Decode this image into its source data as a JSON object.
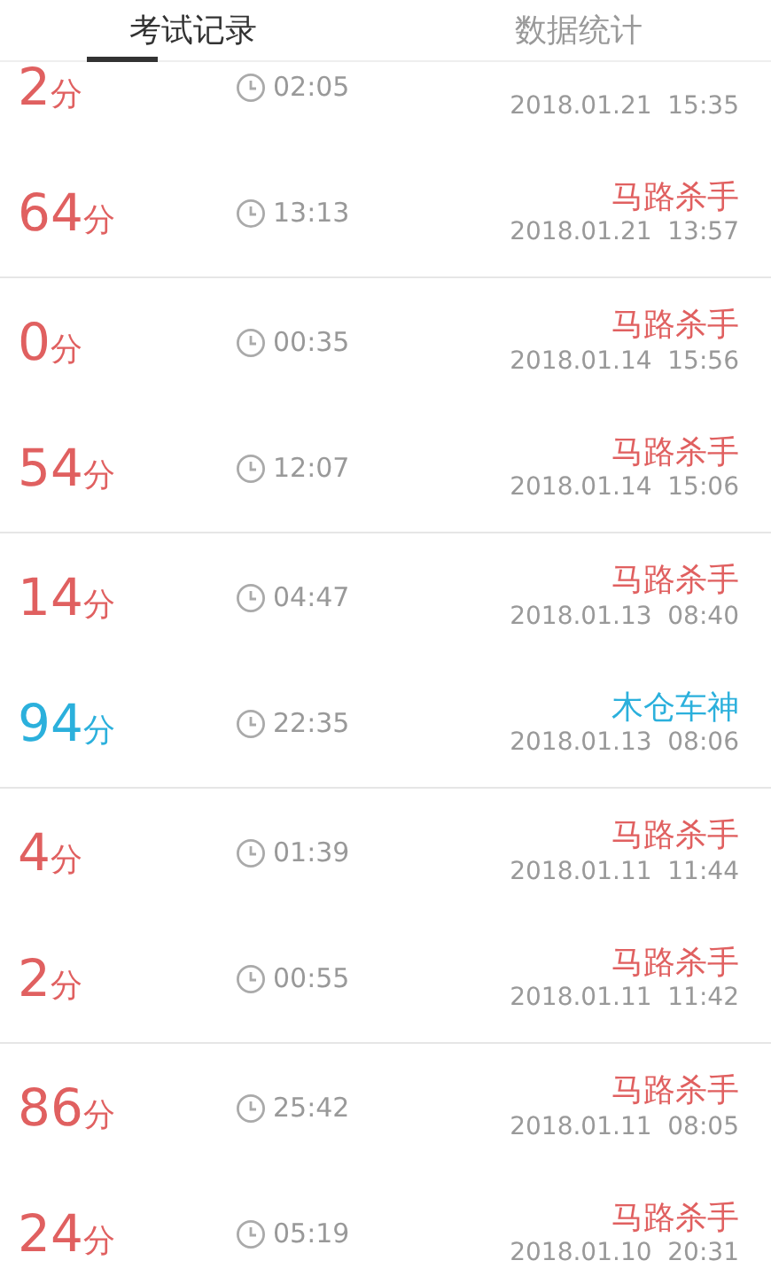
{
  "tabs": [
    {
      "label": "考试记录",
      "selected": true
    },
    {
      "label": "数据统计",
      "selected": false
    }
  ],
  "records": [
    {
      "score": "2",
      "unit": "分",
      "duration": "02:05",
      "date": "2018.01.21  15:35",
      "color": "#e06060"
    },
    {
      "score": "64",
      "unit": "分",
      "duration": "13:13",
      "title": "马路杀手",
      "date": "2018.01.21  13:57",
      "color": "#e06060"
    },
    {
      "score": "0",
      "unit": "分",
      "duration": "00:35",
      "title": "马路杀手",
      "date": "2018.01.14  15:56",
      "color": "#e06060"
    },
    {
      "score": "54",
      "unit": "分",
      "duration": "12:07",
      "title": "马路杀手",
      "date": "2018.01.14  15:06",
      "color": "#e06060"
    },
    {
      "score": "14",
      "unit": "分",
      "duration": "04:47",
      "title": "马路杀手",
      "date": "2018.01.13  08:40",
      "color": "#e06060"
    },
    {
      "score": "94",
      "unit": "分",
      "duration": "22:35",
      "title": "木仓车神",
      "date": "2018.01.13  08:06",
      "color": "#2bb0dc"
    },
    {
      "score": "4",
      "unit": "分",
      "duration": "01:39",
      "title": "马路杀手",
      "date": "2018.01.11  11:44",
      "color": "#e06060"
    },
    {
      "score": "2",
      "unit": "分",
      "duration": "00:55",
      "title": "马路杀手",
      "date": "2018.01.11  11:42",
      "color": "#e06060"
    },
    {
      "score": "86",
      "unit": "分",
      "duration": "25:42",
      "title": "马路杀手",
      "date": "2018.01.11  08:05",
      "color": "#e06060"
    },
    {
      "score": "24",
      "unit": "分",
      "duration": "05:19",
      "title": "马路杀手",
      "date": "2018.01.10  20:31",
      "color": "#e06060"
    }
  ]
}
